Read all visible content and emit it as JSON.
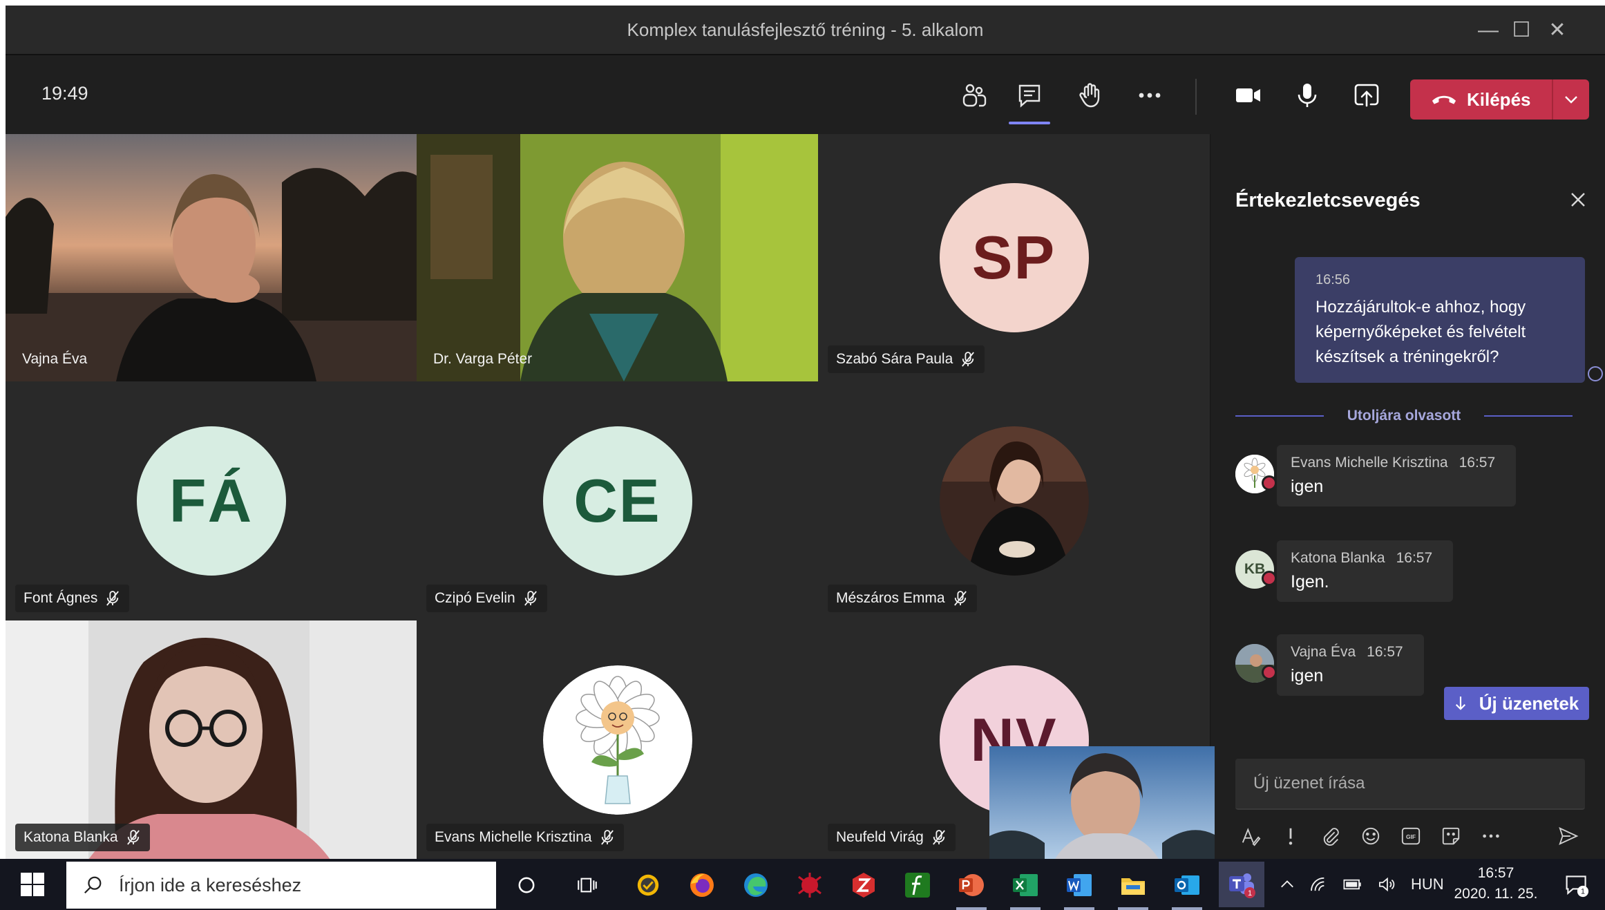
{
  "window": {
    "title": "Komplex tanulásfejlesztő tréning - 5. alkalom",
    "controls": {
      "minimize": "—",
      "maximize": "☐",
      "close": "✕"
    }
  },
  "toolbar": {
    "time": "19:49",
    "leave_label": "Kilépés",
    "accent": "#c4314b"
  },
  "participants": [
    {
      "name": "Vajna Éva",
      "type": "video",
      "muted": false
    },
    {
      "name": "Dr. Varga Péter",
      "type": "video",
      "muted": false
    },
    {
      "name": "Szabó Sára Paula",
      "type": "avatar",
      "initials": "SP",
      "bg": "#f3d4cc",
      "fg": "#6b1d1d",
      "muted": true
    },
    {
      "name": "Font Ágnes",
      "type": "avatar",
      "initials": "FÁ",
      "bg": "#d7ede2",
      "fg": "#1c5a3b",
      "muted": true
    },
    {
      "name": "Czipó Evelin",
      "type": "avatar",
      "initials": "CE",
      "bg": "#d7ede2",
      "fg": "#1c5a3b",
      "muted": true
    },
    {
      "name": "Mészáros Emma",
      "type": "photo",
      "muted": true
    },
    {
      "name": "Katona Blanka",
      "type": "video",
      "muted": true
    },
    {
      "name": "Evans Michelle Krisztina",
      "type": "photo",
      "muted": true
    },
    {
      "name": "Neufeld Virág",
      "type": "avatar",
      "initials": "NV",
      "bg": "#f2d1db",
      "fg": "#5c1a2e",
      "muted": true
    }
  ],
  "chat": {
    "title": "Értekezletcsevegés",
    "own_message": {
      "time": "16:56",
      "text": "Hozzájárultok-e ahhoz, hogy képernyőképeket és felvételt készítsek a tréningekről?"
    },
    "last_read_label": "Utoljára olvasott",
    "messages": [
      {
        "author": "Evans Michelle Krisztina",
        "time": "16:57",
        "text": "igen",
        "initials": ""
      },
      {
        "author": "Katona Blanka",
        "time": "16:57",
        "text": "Igen.",
        "initials": "KB"
      },
      {
        "author": "Vajna Éva",
        "time": "16:57",
        "text": "igen",
        "initials": ""
      }
    ],
    "new_messages_label": "Új üzenetek",
    "compose_placeholder": "Új üzenet írása",
    "gif_label": "GIF"
  },
  "taskbar": {
    "search_placeholder": "Írjon ide a kereséshez",
    "language": "HUN",
    "time": "16:57",
    "date": "2020. 11. 25.",
    "notification_count": "1",
    "teams_badge": "1"
  }
}
